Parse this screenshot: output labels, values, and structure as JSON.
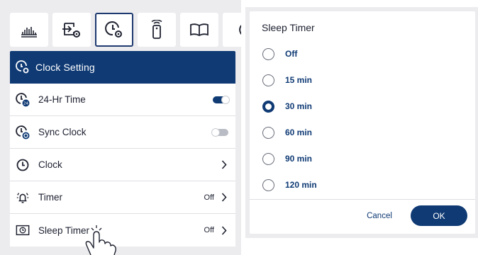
{
  "colors": {
    "brand": "#0f3a74",
    "panel_bg": "#ececef",
    "toggle_off": "#b9bcc4"
  },
  "tabs": [
    {
      "icon": "picture-mode-icon"
    },
    {
      "icon": "input-settings-icon"
    },
    {
      "icon": "clock-settings-icon",
      "active": true
    },
    {
      "icon": "remote-icon"
    },
    {
      "icon": "book-icon"
    },
    {
      "icon": "partial-tab-icon"
    }
  ],
  "menu": {
    "header": {
      "icon": "clock-settings-icon",
      "title": "Clock Setting"
    },
    "rows": [
      {
        "icon": "clock-24-icon",
        "label": "24-Hr Time",
        "control": "toggle",
        "toggle_on": true
      },
      {
        "icon": "sync-clock-icon",
        "label": "Sync Clock",
        "control": "toggle",
        "toggle_on": false
      },
      {
        "icon": "clock-icon",
        "label": "Clock",
        "control": "chevron"
      },
      {
        "icon": "alarm-bell-icon",
        "label": "Timer",
        "value": "Off",
        "control": "chevron"
      },
      {
        "icon": "sleep-timer-icon",
        "label": "Sleep Timer",
        "value": "Off",
        "control": "chevron"
      }
    ]
  },
  "dialog": {
    "title": "Sleep Timer",
    "options": [
      "Off",
      "15 min",
      "30 min",
      "60 min",
      "90 min",
      "120 min"
    ],
    "selected": "30 min",
    "cancel_label": "Cancel",
    "ok_label": "OK"
  }
}
